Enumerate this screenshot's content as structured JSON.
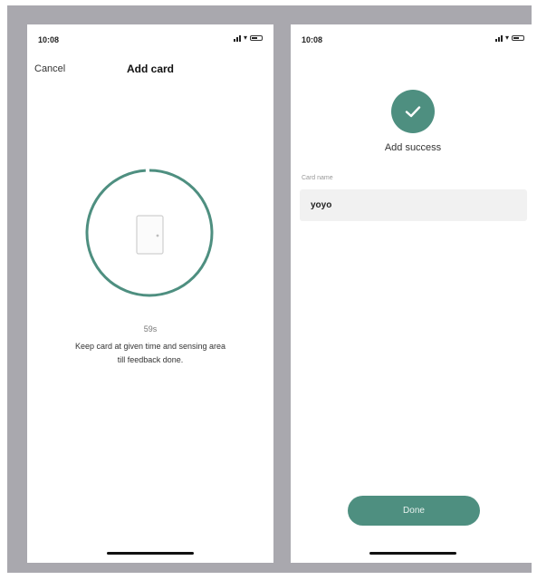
{
  "left_screen": {
    "status_time": "10:08",
    "nav": {
      "cancel_label": "Cancel",
      "title": "Add card"
    },
    "progress": {
      "fraction": 0.99
    },
    "timer_text": "59s",
    "hint_lines": [
      "Keep card at given time and sensing area",
      "till feedback done."
    ]
  },
  "right_screen": {
    "status_time": "10:08",
    "success_text": "Add success",
    "field_label": "Card name",
    "card_name_value": "yoyo",
    "done_label": "Done"
  },
  "colors": {
    "accent": "#4e8f80",
    "frame": "#a9a8ae",
    "field_bg": "#f1f1f1"
  },
  "icons": [
    "signal-icon",
    "wifi-icon",
    "battery-icon",
    "door-icon",
    "checkmark-icon"
  ]
}
